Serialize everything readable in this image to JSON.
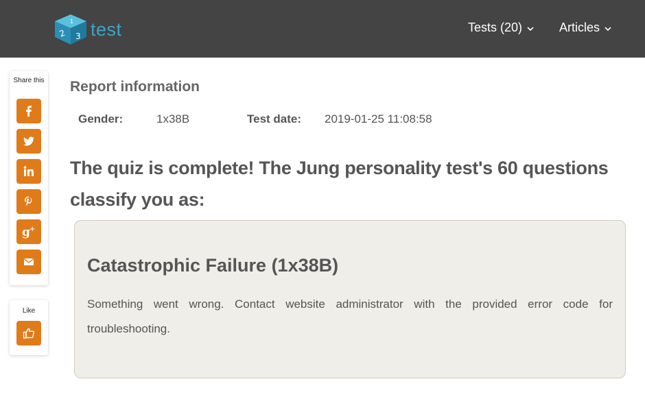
{
  "header": {
    "logo_text": "test",
    "logo_digits": [
      "2",
      "1",
      "3"
    ],
    "nav": [
      {
        "label": "Tests (20)"
      },
      {
        "label": "Articles"
      }
    ]
  },
  "share": {
    "label": "Share this",
    "buttons": [
      "facebook-icon",
      "twitter-icon",
      "linkedin-icon",
      "pinterest-icon",
      "google-plus-icon",
      "email-icon"
    ],
    "like_label": "Like"
  },
  "report": {
    "title": "Report information",
    "gender_label": "Gender:",
    "gender_value": "1x38B",
    "date_label": "Test date:",
    "date_value": "2019-01-25 11:08:58"
  },
  "headline": "The quiz is complete! The Jung personality test's 60 questions classify you as:",
  "result": {
    "title": "Catastrophic Failure (1x38B)",
    "text": "Something went wrong. Contact website administrator with the provided error code for troubleshooting."
  },
  "colors": {
    "header_bg": "#444444",
    "accent": "#e07b1a",
    "logo": "#3ba6c9",
    "result_bg": "#efeee9"
  }
}
